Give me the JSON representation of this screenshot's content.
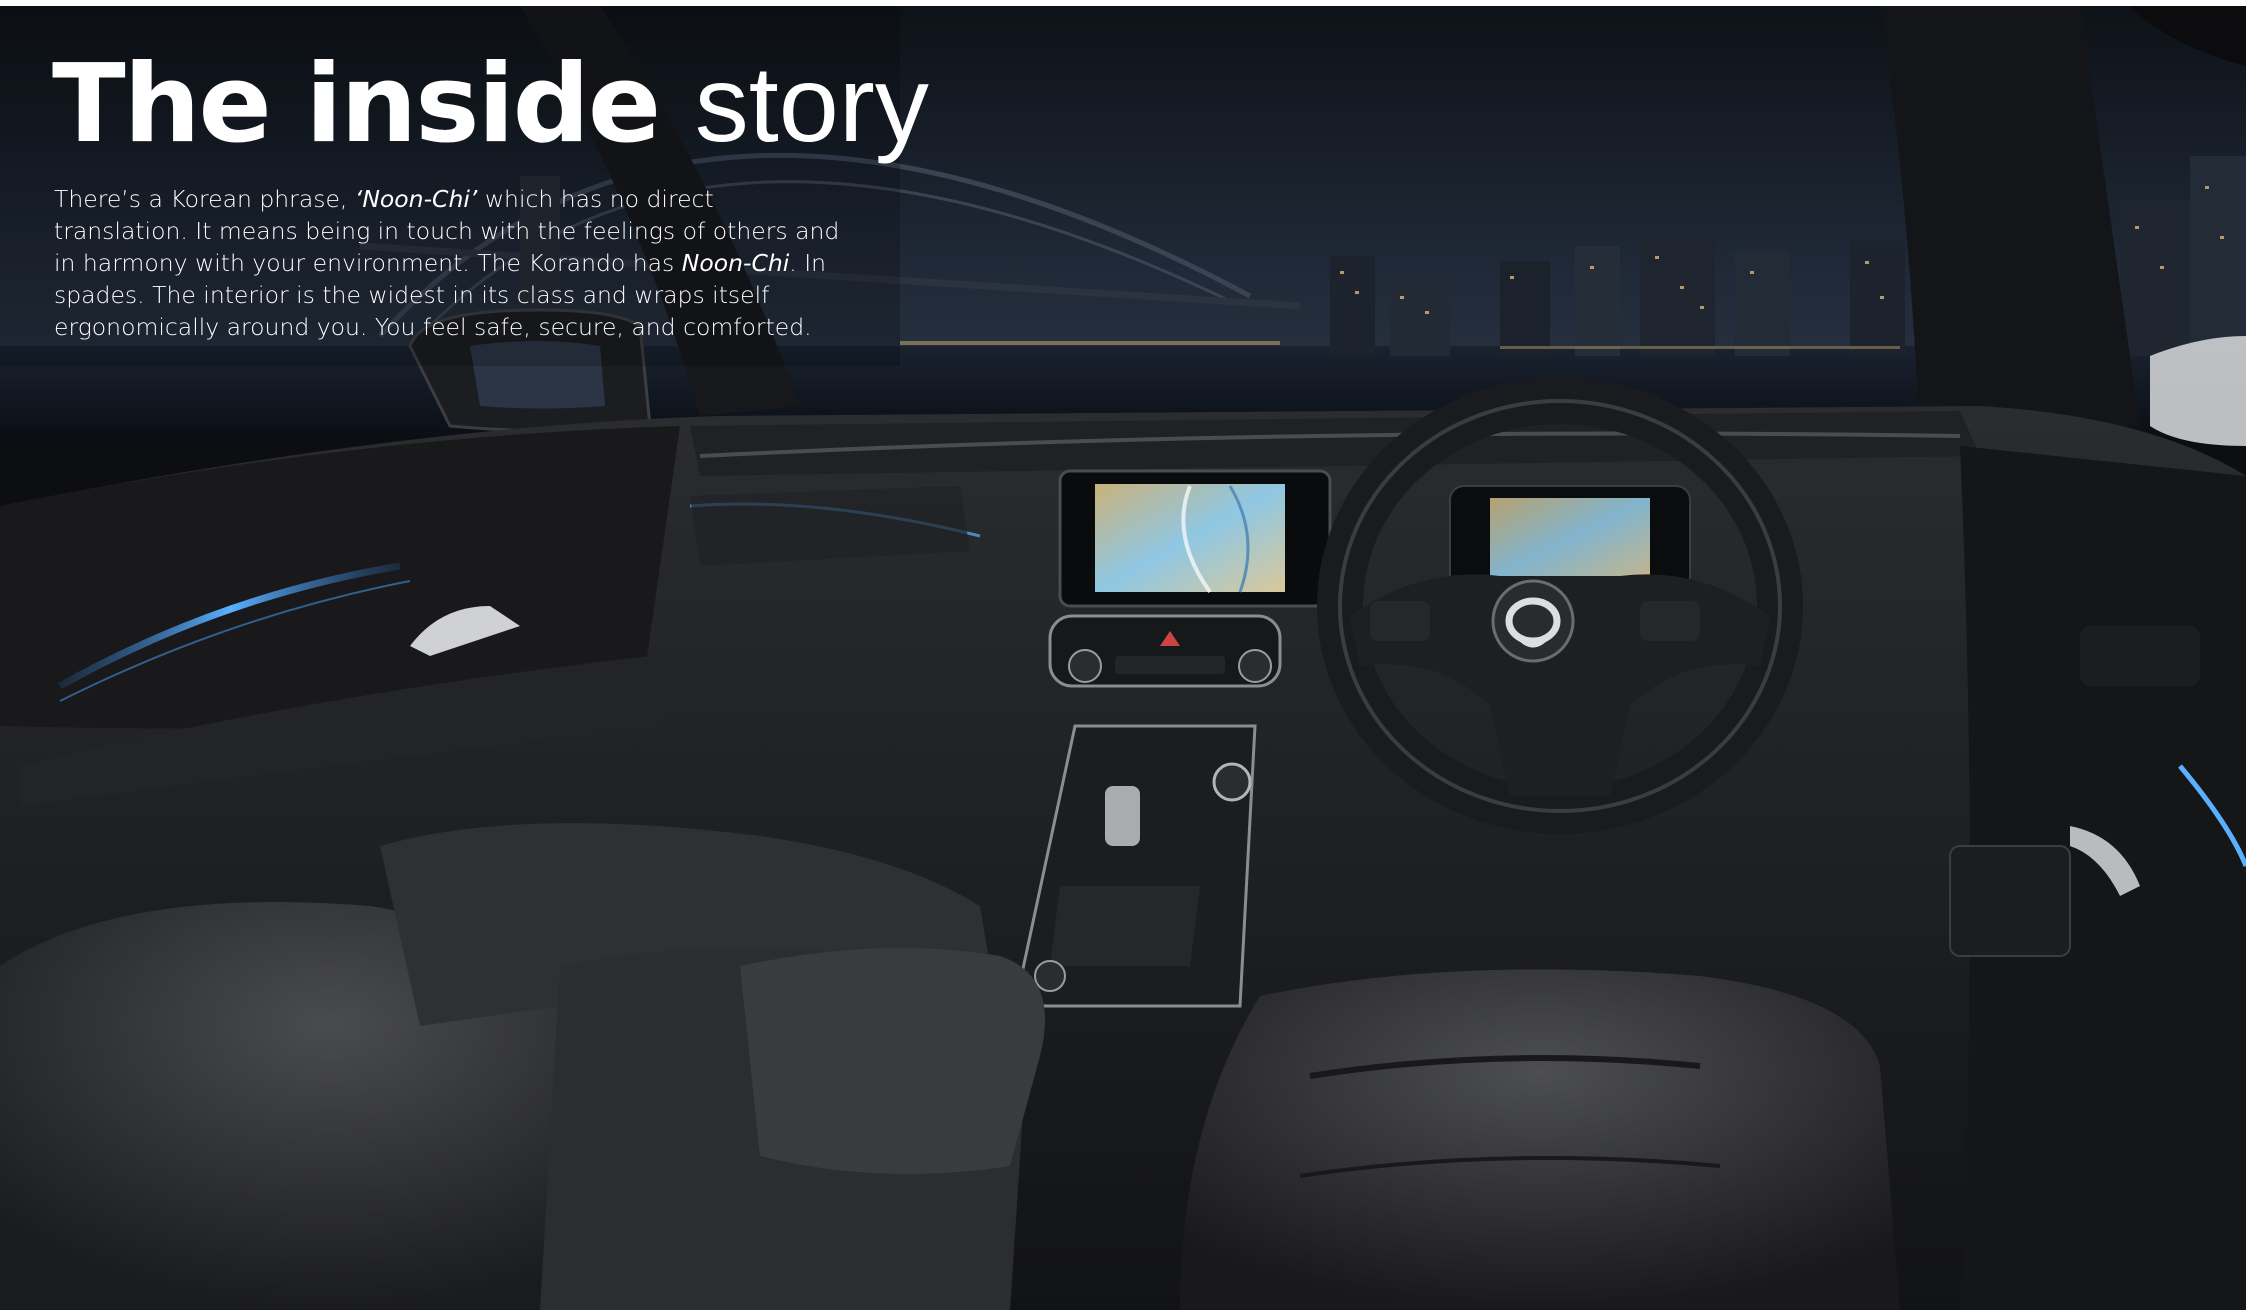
{
  "page": {
    "headline_bold": "The inside",
    "headline_light": "story",
    "intro": {
      "part1": "There’s a Korean phrase, ",
      "term1": "‘Noon-Chi’",
      "part2": " which has no direct translation. It means being in touch with the feelings of others and in harmony with your environment. The Korando has ",
      "term2": "Noon-Chi",
      "part3": ". In spades. The interior is the widest in its class and wraps itself ergonomically around you. You feel safe, secure, and comforted."
    }
  },
  "photo": {
    "subject": "vehicle-interior-at-night",
    "steering_wheel_logo": "ssangyong-logo",
    "colors": {
      "sky": "#1c2330",
      "upholstery": "#2b2c2e",
      "ambient_light": "#3f8fd6",
      "city_lights": "#e9c27a"
    }
  }
}
